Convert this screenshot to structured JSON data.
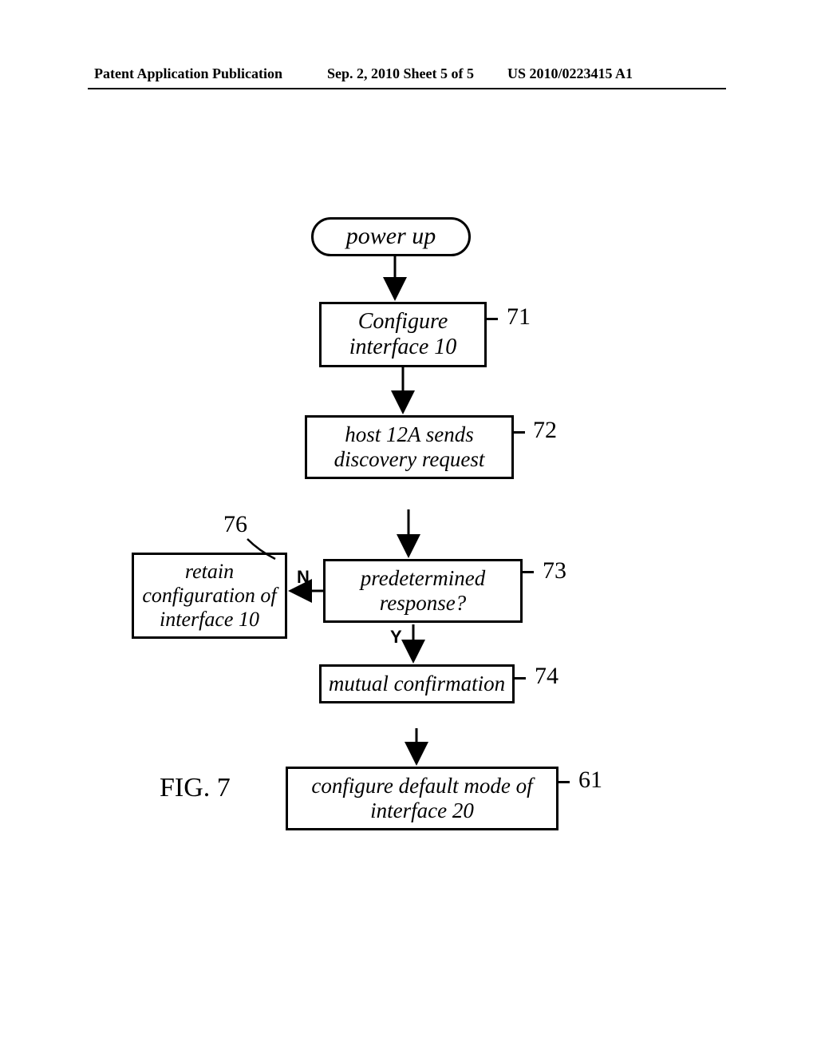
{
  "header": {
    "left": "Patent Application Publication",
    "mid": "Sep. 2, 2010   Sheet 5 of 5",
    "right": "US 2010/0223415 A1"
  },
  "figure_label": "FIG. 7",
  "nodes": {
    "start": "power up",
    "b71": "Configure\ninterface 10",
    "b72": "host 12A\nsends discovery\nrequest",
    "b73": "predetermined\nresponse?",
    "b74": "mutual\nconfirmation",
    "b61": "configure default\nmode of interface 20",
    "b76": "retain\nconfiguration\nof interface 10"
  },
  "refs": {
    "r71": "71",
    "r72": "72",
    "r73": "73",
    "r74": "74",
    "r61": "61",
    "r76": "76"
  },
  "branches": {
    "yes": "Y",
    "no": "N"
  }
}
